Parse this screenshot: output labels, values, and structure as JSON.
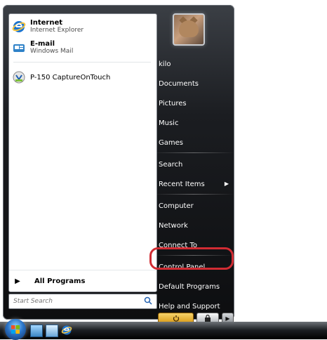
{
  "start_menu": {
    "pinned": [
      {
        "title": "Internet",
        "subtitle": "Internet Explorer",
        "icon": "internet-explorer-icon"
      },
      {
        "title": "E-mail",
        "subtitle": "Windows Mail",
        "icon": "windows-mail-icon"
      }
    ],
    "recent": [
      {
        "title": "P-150 CaptureOnTouch",
        "icon": "captureontouch-icon"
      }
    ],
    "all_programs": "All Programs",
    "search": {
      "placeholder": "Start Search"
    },
    "right_items": [
      {
        "label": "kilo"
      },
      {
        "label": "Documents"
      },
      {
        "label": "Pictures"
      },
      {
        "label": "Music"
      },
      {
        "label": "Games"
      },
      {
        "label": "Search"
      },
      {
        "label": "Recent Items"
      },
      {
        "label": "Computer"
      },
      {
        "label": "Network"
      },
      {
        "label": "Connect To"
      },
      {
        "label": "Control Panel"
      },
      {
        "label": "Default Programs"
      },
      {
        "label": "Help and Support"
      }
    ],
    "highlighted": "Control Panel"
  },
  "taskbar": {
    "quick_launch": [
      "show-desktop-icon",
      "switch-windows-icon",
      "internet-explorer-icon"
    ]
  },
  "colors": {
    "highlight": "#d12c33",
    "menu_background": "#1b1d21",
    "power_button": "#e4ad33"
  }
}
